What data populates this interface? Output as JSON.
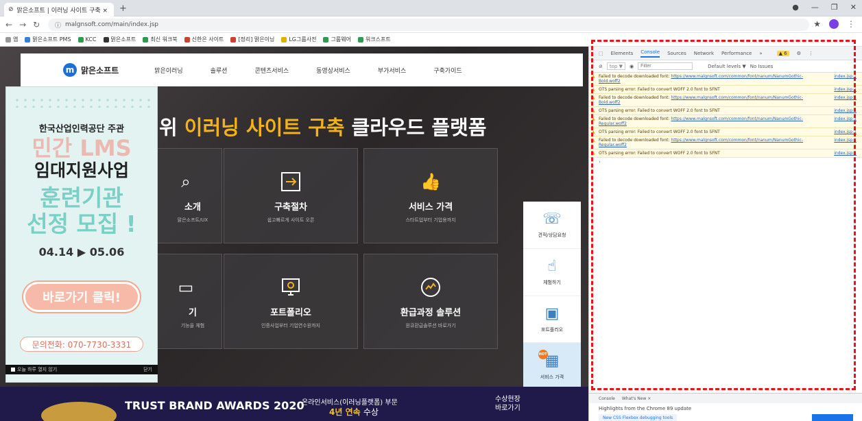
{
  "browser": {
    "tab_title": "맑은소프트 | 이러닝 사이트 구축 ×",
    "new_tab": "+",
    "url": "malgnsoft.com/main/index.jsp",
    "bookmarks": [
      "앱",
      "맑은소프트 PMS",
      "KCC",
      "맑은소프트",
      "최신 워크북",
      "신한은 사이트",
      "[정리] 맑은이닝",
      "LG그룹사전",
      "그룹웨어",
      "워크스프트"
    ]
  },
  "site": {
    "logo_mark": "m",
    "logo_text": "맑은소프트",
    "menu": [
      "맑은이러닝",
      "솔루션",
      "콘텐츠서비스",
      "동영상서비스",
      "부가서비스",
      "구축가이드"
    ],
    "headline_white": "위",
    "headline_yellow": "이러닝 사이트 구축",
    "headline_rest": "클라우드 플랫폼",
    "cards": [
      {
        "title": "소개",
        "sub": "맑은소프트/UX"
      },
      {
        "title": "구축절차",
        "sub": "쉽고빠르게 사이트 오픈"
      },
      {
        "title": "서비스 가격",
        "sub": "스타트업부터 기업용까지"
      },
      {
        "title": "기",
        "sub": "기능을 체험"
      },
      {
        "title": "포트폴리오",
        "sub": "인증사업부터 기업연수원까지"
      },
      {
        "title": "환급과정 솔루션",
        "sub": "원큐환급솔루션 바로가기"
      }
    ],
    "quick_menu": [
      "견적/상담요청",
      "체험하기",
      "포트폴리오",
      "서비스 가격"
    ],
    "quick_badge": "HOT",
    "awards_title": "TRUST BRAND AWARDS 2020",
    "awards_sub": "온라인서비스(이러닝플랫폼) 부문",
    "awards_years": "4년 연속",
    "awards_years_suffix": "수상",
    "awards_link_1": "수상현장",
    "awards_link_2": "바로가기"
  },
  "popup": {
    "line1": "한국산업인력공단 주관",
    "line2": "민간 LMS",
    "line3": "임대지원사업",
    "line4a": "훈련기관",
    "line4b": "선정 모집 !",
    "dates": "04.14 ▶ 05.06",
    "button": "바로가기 클릭!",
    "phone": "문의전화: 070-7730-3331",
    "footer_check": "오늘 하루 열지 않기",
    "footer_close": "닫기"
  },
  "devtools": {
    "tabs": [
      "Elements",
      "Console",
      "Sources",
      "Network",
      "Performance",
      "»"
    ],
    "active_tab": "Console",
    "warn_count": "▲ 6",
    "context": "top",
    "filter_placeholder": "Filter",
    "levels": "Default levels ▼",
    "issues": "No Issues",
    "logs": [
      {
        "msg": "Failed to decode downloaded font: ",
        "url": "https://www.malgnsoft.com/common/font/nanum/NanumGothic-Bold.woff2",
        "src": "index.jsp:1"
      },
      {
        "msg": "OTS parsing error: Failed to convert WOFF 2.0 font to SFNT",
        "url": "",
        "src": "index.jsp:1"
      },
      {
        "msg": "Failed to decode downloaded font: ",
        "url": "https://www.malgnsoft.com/common/font/nanum/NanumGothic-Bold.woff2",
        "src": "index.jsp:1"
      },
      {
        "msg": "OTS parsing error: Failed to convert WOFF 2.0 font to SFNT",
        "url": "",
        "src": "index.jsp:1"
      },
      {
        "msg": "Failed to decode downloaded font: ",
        "url": "https://www.malgnsoft.com/common/font/nanum/NanumGothic-Regular.woff2",
        "src": "index.jsp:1"
      },
      {
        "msg": "OTS parsing error: Failed to convert WOFF 2.0 font to SFNT",
        "url": "",
        "src": "index.jsp:1"
      },
      {
        "msg": "Failed to decode downloaded font: ",
        "url": "https://www.malgnsoft.com/common/font/nanum/NanumGothic-Regular.woff2",
        "src": "index.jsp:1"
      },
      {
        "msg": "OTS parsing error: Failed to convert WOFF 2.0 font to SFNT",
        "url": "",
        "src": "index.jsp:1"
      }
    ],
    "prompt": "›",
    "drawer_tabs": [
      "Console",
      "What's New ×"
    ],
    "drawer_line": "Highlights from the Chrome 89 update",
    "drawer_link": "New CSS Flexbox debugging tools"
  },
  "colors": {
    "highlight": "#e8141c",
    "accent_yellow": "#f2b21c",
    "brand_blue": "#1d6fd6"
  }
}
